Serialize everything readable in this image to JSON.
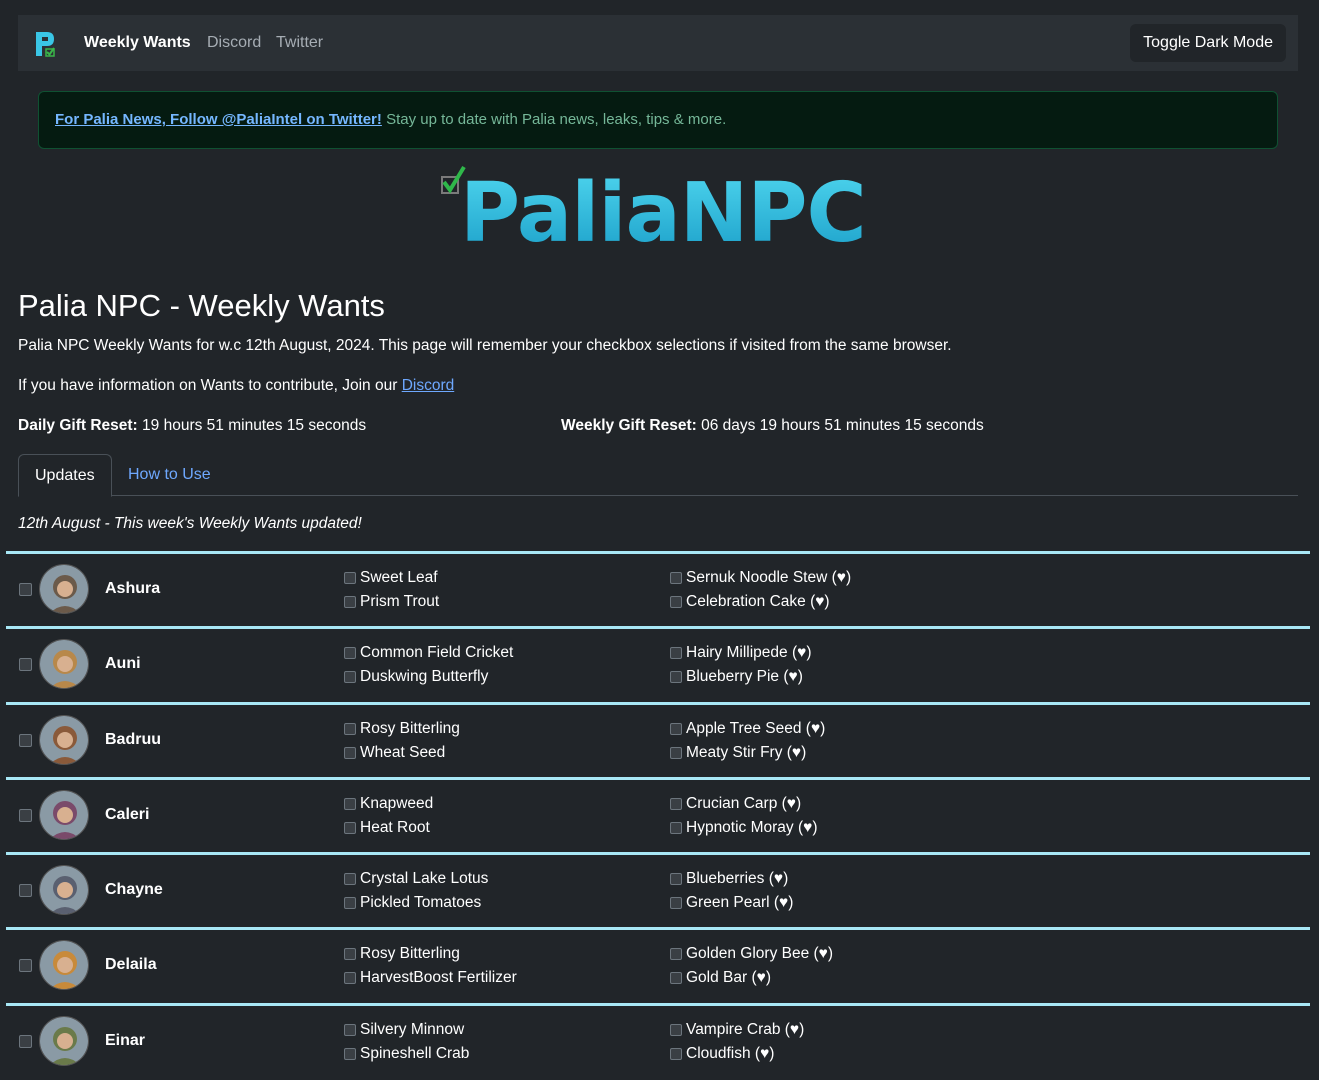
{
  "nav": {
    "brand": "Weekly Wants",
    "links": [
      "Discord",
      "Twitter"
    ],
    "toggle_label": "Toggle Dark Mode"
  },
  "alert": {
    "link_text": "For Palia News, Follow @PaliaIntel on Twitter!",
    "text": " Stay up to date with Palia news, leaks, tips & more."
  },
  "logo_text": "PaliaNPC",
  "page": {
    "title": "Palia NPC - Weekly Wants",
    "intro": "Palia NPC Weekly Wants for w.c 12th August, 2024. This page will remember your checkbox selections if visited from the same browser.",
    "contribute_prefix": "If you have information on Wants to contribute, Join our ",
    "contribute_link": "Discord",
    "daily_label": "Daily Gift Reset:",
    "daily_value": " 19 hours 51 minutes 15 seconds",
    "weekly_label": "Weekly Gift Reset:",
    "weekly_value": " 06 days 19 hours 51 minutes 15 seconds"
  },
  "tabs": [
    "Updates",
    "How to Use"
  ],
  "update_note": "12th August - This week's Weekly Wants updated!",
  "npcs": [
    {
      "name": "Ashura",
      "wants": [
        "Sweet Leaf",
        "Prism Trout",
        "Sernuk Noodle Stew (♥)",
        "Celebration Cake (♥)"
      ],
      "avatar_color": "#6b5a4a"
    },
    {
      "name": "Auni",
      "wants": [
        "Common Field Cricket",
        "Duskwing Butterfly",
        "Hairy Millipede (♥)",
        "Blueberry Pie (♥)"
      ],
      "avatar_color": "#b8884a"
    },
    {
      "name": "Badruu",
      "wants": [
        "Rosy Bitterling",
        "Wheat Seed",
        "Apple Tree Seed (♥)",
        "Meaty Stir Fry (♥)"
      ],
      "avatar_color": "#8a5a3a"
    },
    {
      "name": "Caleri",
      "wants": [
        "Knapweed",
        "Heat Root",
        "Crucian Carp (♥)",
        "Hypnotic Moray (♥)"
      ],
      "avatar_color": "#7a4a6a"
    },
    {
      "name": "Chayne",
      "wants": [
        "Crystal Lake Lotus",
        "Pickled Tomatoes",
        "Blueberries (♥)",
        "Green Pearl (♥)"
      ],
      "avatar_color": "#5a6070"
    },
    {
      "name": "Delaila",
      "wants": [
        "Rosy Bitterling",
        "HarvestBoost Fertilizer",
        "Golden Glory Bee (♥)",
        "Gold Bar (♥)"
      ],
      "avatar_color": "#c88a3a"
    },
    {
      "name": "Einar",
      "wants": [
        "Silvery Minnow",
        "Spineshell Crab",
        "Vampire Crab (♥)",
        "Cloudfish (♥)"
      ],
      "avatar_color": "#6a7a4a"
    }
  ]
}
